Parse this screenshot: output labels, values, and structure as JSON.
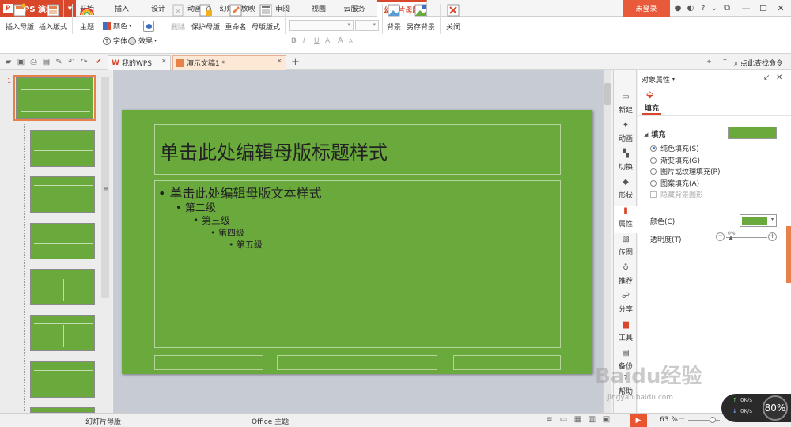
{
  "app": {
    "name": "WPS 演示",
    "login": "未登录"
  },
  "tabs": [
    "开始",
    "插入",
    "设计",
    "动画",
    "幻灯片放映",
    "审阅",
    "视图",
    "云服务",
    "幻灯片母版"
  ],
  "ribbon": {
    "insert_master": "插入母版",
    "insert_layout": "插入版式",
    "theme": "主题",
    "color": "颜色",
    "font": "字体",
    "effect": "效果",
    "delete": "删除",
    "protect_master": "保护母版",
    "rename": "重命名",
    "master_layout": "母版版式",
    "background": "背景",
    "save_background": "另存背景",
    "close": "关闭",
    "bold": "B",
    "italic": "I",
    "underline": "U",
    "shadow": "A",
    "font_size_up": "A",
    "font_size_down": "A"
  },
  "docbar": {
    "tab1": "我的WPS",
    "tab2": "演示文稿1 *",
    "search": "点此查找命令"
  },
  "slide": {
    "title": "单击此处编辑母版标题样式",
    "level1": "单击此处编辑母版文本样式",
    "level2": "第二级",
    "level3": "第三级",
    "level4": "第四级",
    "level5": "第五级",
    "thumb_number": "1"
  },
  "sidetabs": [
    "新建",
    "动画",
    "切换",
    "形状",
    "属性",
    "传图",
    "推荐",
    "分享",
    "工具",
    "备份",
    "帮助"
  ],
  "properties": {
    "header": "对象属性",
    "fill_tab": "填充",
    "fill_section": "填充",
    "solid": "纯色填充(S)",
    "gradient": "渐变填充(G)",
    "picture": "图片或纹理填充(P)",
    "pattern": "图案填充(A)",
    "hide_bg": "隐藏背景图形",
    "color_label": "颜色(C)",
    "transparency_label": "透明度(T)",
    "transparency_value": "0%",
    "fill_color": "#6aaa3c"
  },
  "status": {
    "left": "幻灯片母版",
    "theme": "Office 主题",
    "zoom": "63 %"
  },
  "net": {
    "percent": "80%",
    "up": "0K/s",
    "down": "0K/s"
  },
  "watermark": {
    "main": "Baidu经验",
    "sub": "jingyan.baidu.com"
  },
  "colors": {
    "accent": "#d9472b",
    "slide_green": "#6aaa3c"
  }
}
